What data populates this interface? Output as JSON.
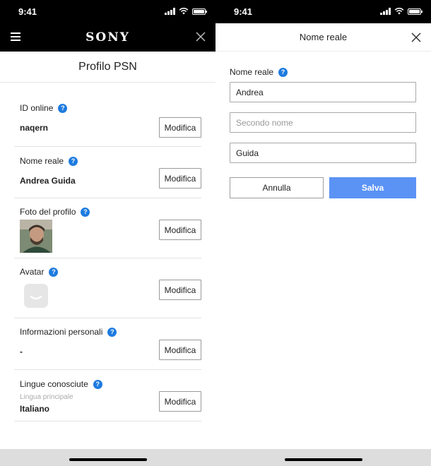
{
  "status_bar": {
    "time": "9:41"
  },
  "left_screen": {
    "brand": "SONY",
    "page_title": "Profilo PSN",
    "rows": [
      {
        "label": "ID online",
        "value": "naqern",
        "button": "Modifica"
      },
      {
        "label": "Nome reale",
        "value": "Andrea Guida",
        "button": "Modifica"
      },
      {
        "label": "Foto del profilo",
        "button": "Modifica"
      },
      {
        "label": "Avatar",
        "button": "Modifica"
      },
      {
        "label": "Informazioni personali",
        "value": "-",
        "button": "Modifica"
      },
      {
        "label": "Lingue conosciute",
        "sub": "Lingua principale",
        "value": "Italiano",
        "button": "Modifica"
      }
    ]
  },
  "right_screen": {
    "title": "Nome reale",
    "field_label": "Nome reale",
    "first_name": "Andrea",
    "middle_name_placeholder": "Secondo nome",
    "last_name": "Guida",
    "cancel_label": "Annulla",
    "save_label": "Salva"
  },
  "colors": {
    "accent": "#5b93f5",
    "help": "#1e7be0",
    "header": "#000000"
  },
  "icons": [
    "menu-icon",
    "close-icon",
    "help-icon",
    "avatar-icon",
    "signal-icon",
    "wifi-icon",
    "battery-icon"
  ]
}
